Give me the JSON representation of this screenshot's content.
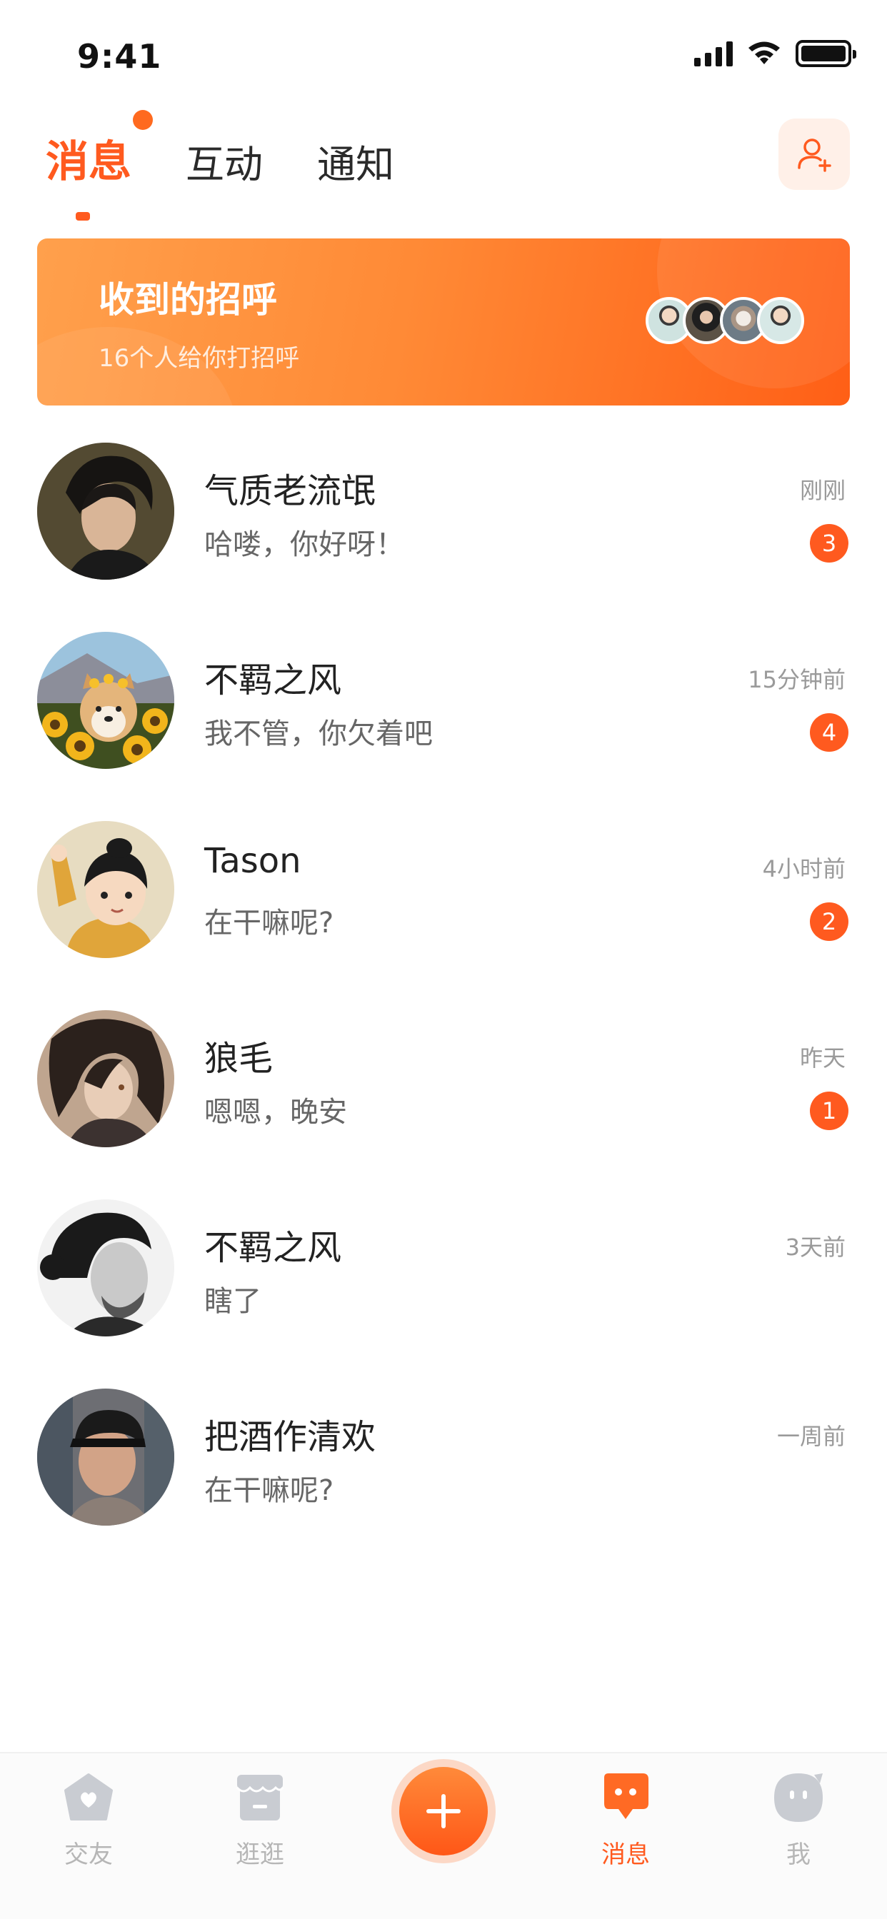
{
  "status_bar": {
    "time": "9:41"
  },
  "top_tabs": [
    {
      "label": "消息",
      "active": true
    },
    {
      "label": "互动",
      "active": false
    },
    {
      "label": "通知",
      "active": false
    }
  ],
  "greeting": {
    "title": "收到的招呼",
    "subtitle": "16个人给你打招呼"
  },
  "chats": [
    {
      "name": "气质老流氓",
      "message": "哈喽，你好呀！",
      "time": "刚刚",
      "unread": "3",
      "avatar": "dark-hair-man"
    },
    {
      "name": "不羁之风",
      "message": "我不管，你欠着吧",
      "time": "15分钟前",
      "unread": "4",
      "avatar": "shiba-dog-sunflowers"
    },
    {
      "name": "Tason",
      "message": "在干嘛呢?",
      "time": "4小时前",
      "unread": "2",
      "avatar": "cartoon-boy"
    },
    {
      "name": "狼毛",
      "message": "嗯嗯，晚安",
      "time": "昨天",
      "unread": "1",
      "avatar": "anime-character"
    },
    {
      "name": "不羁之风",
      "message": "瞎了",
      "time": "3天前",
      "unread": "",
      "avatar": "bw-man-portrait"
    },
    {
      "name": "把酒作清欢",
      "message": "在干嘛呢?",
      "time": "一周前",
      "unread": "",
      "avatar": "man-with-cap"
    }
  ],
  "bottom_nav": {
    "items": [
      {
        "label": "交友",
        "icon": "heart-house-icon",
        "active": false
      },
      {
        "label": "逛逛",
        "icon": "store-icon",
        "active": false
      },
      {
        "label": "消息",
        "icon": "chat-bubble-icon",
        "active": true
      },
      {
        "label": "我",
        "icon": "profile-icon",
        "active": false
      }
    ],
    "publish_icon": "plus-icon"
  },
  "colors": {
    "accent": "#ff5a1f",
    "banner_start": "#ffa04c",
    "banner_end": "#ff5f16"
  }
}
